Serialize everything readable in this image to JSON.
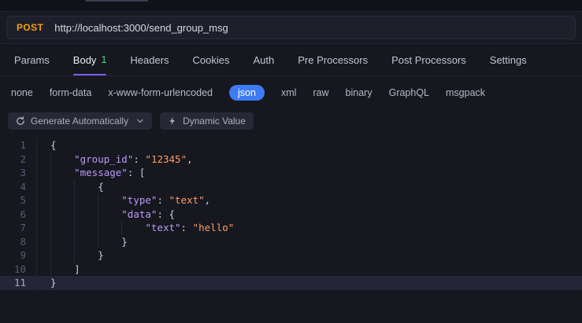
{
  "colors": {
    "method": "#f59e0b",
    "badge": "#4ade80",
    "accent": "#7a5af8",
    "pill": "#3d7bf4",
    "key": "#bb9af7",
    "string": "#ff9e64",
    "punct": "#c9cede"
  },
  "request_bar": {
    "method": "POST",
    "url": "http://localhost:3000/send_group_msg"
  },
  "tabs": {
    "items": [
      {
        "label": "Params"
      },
      {
        "label": "Body",
        "badge": "1",
        "active": true
      },
      {
        "label": "Headers"
      },
      {
        "label": "Cookies"
      },
      {
        "label": "Auth"
      },
      {
        "label": "Pre Processors"
      },
      {
        "label": "Post Processors"
      },
      {
        "label": "Settings"
      }
    ]
  },
  "body_types": {
    "selected": "json",
    "options": [
      "none",
      "form-data",
      "x-www-form-urlencoded",
      "json",
      "xml",
      "raw",
      "binary",
      "GraphQL",
      "msgpack"
    ]
  },
  "toolbar": {
    "generate_label": "Generate Automatically",
    "dynamic_label": "Dynamic Value"
  },
  "editor": {
    "active_line": 11,
    "lines": [
      {
        "num": 1,
        "indent": 0,
        "tokens": [
          [
            "p",
            "{"
          ]
        ]
      },
      {
        "num": 2,
        "indent": 1,
        "tokens": [
          [
            "k",
            "\"group_id\""
          ],
          [
            "p",
            ": "
          ],
          [
            "s",
            "\"12345\""
          ],
          [
            "p",
            ","
          ]
        ]
      },
      {
        "num": 3,
        "indent": 1,
        "tokens": [
          [
            "k",
            "\"message\""
          ],
          [
            "p",
            ": ["
          ]
        ]
      },
      {
        "num": 4,
        "indent": 2,
        "tokens": [
          [
            "p",
            "{"
          ]
        ]
      },
      {
        "num": 5,
        "indent": 3,
        "tokens": [
          [
            "k",
            "\"type\""
          ],
          [
            "p",
            ": "
          ],
          [
            "s",
            "\"text\""
          ],
          [
            "p",
            ","
          ]
        ]
      },
      {
        "num": 6,
        "indent": 3,
        "tokens": [
          [
            "k",
            "\"data\""
          ],
          [
            "p",
            ": {"
          ]
        ]
      },
      {
        "num": 7,
        "indent": 4,
        "tokens": [
          [
            "k",
            "\"text\""
          ],
          [
            "p",
            ": "
          ],
          [
            "s",
            "\"hello\""
          ]
        ]
      },
      {
        "num": 8,
        "indent": 3,
        "tokens": [
          [
            "p",
            "}"
          ]
        ]
      },
      {
        "num": 9,
        "indent": 2,
        "tokens": [
          [
            "p",
            "}"
          ]
        ]
      },
      {
        "num": 10,
        "indent": 1,
        "tokens": [
          [
            "p",
            "]"
          ]
        ]
      },
      {
        "num": 11,
        "indent": 0,
        "tokens": [
          [
            "p",
            "}"
          ]
        ]
      }
    ]
  }
}
